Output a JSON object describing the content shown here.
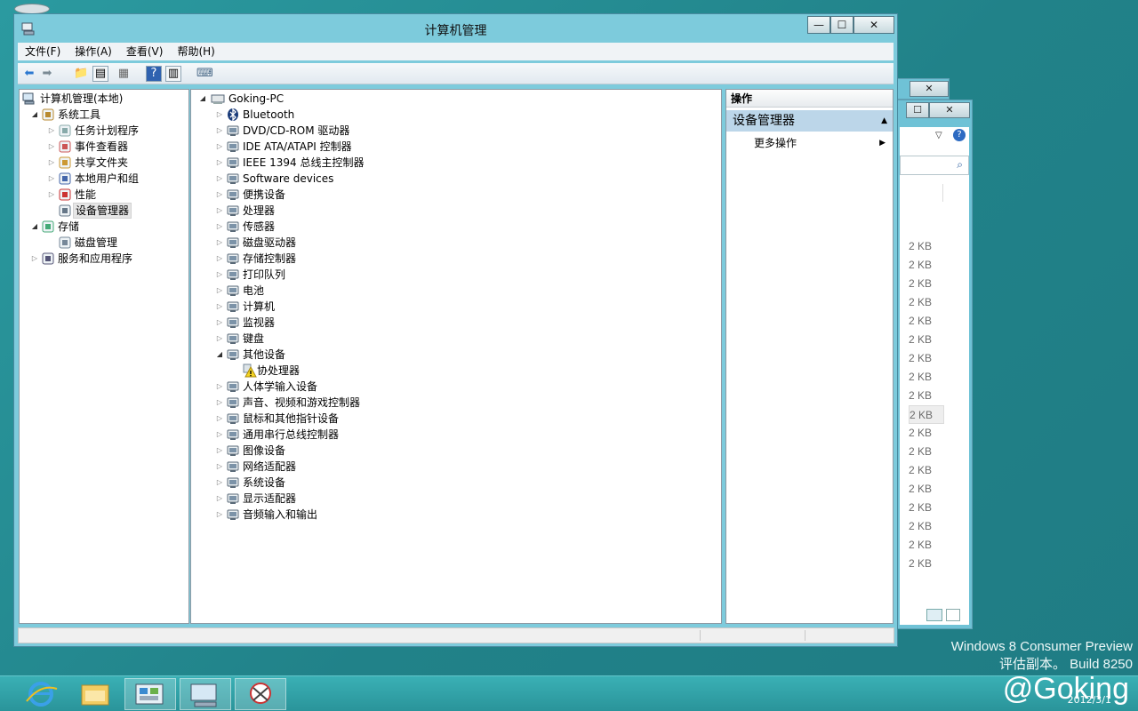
{
  "window": {
    "title": "计算机管理",
    "controls": {
      "minimize": "—",
      "maximize": "☐",
      "close": "✕"
    }
  },
  "menu": [
    "文件(F)",
    "操作(A)",
    "查看(V)",
    "帮助(H)"
  ],
  "left_tree": {
    "root": "计算机管理(本地)",
    "items": [
      {
        "label": "系统工具",
        "level": 1
      },
      {
        "label": "任务计划程序",
        "level": 2
      },
      {
        "label": "事件查看器",
        "level": 2
      },
      {
        "label": "共享文件夹",
        "level": 2
      },
      {
        "label": "本地用户和组",
        "level": 2
      },
      {
        "label": "性能",
        "level": 2
      },
      {
        "label": "设备管理器",
        "level": 2
      },
      {
        "label": "存储",
        "level": 1
      },
      {
        "label": "磁盘管理",
        "level": 2
      },
      {
        "label": "服务和应用程序",
        "level": 1
      }
    ]
  },
  "device_tree": {
    "root": "Goking-PC",
    "items": [
      {
        "label": "Bluetooth",
        "icon": "bluetooth-icon"
      },
      {
        "label": "DVD/CD-ROM 驱动器",
        "icon": "dvd-drive-icon"
      },
      {
        "label": "IDE ATA/ATAPI 控制器",
        "icon": "ide-controller-icon"
      },
      {
        "label": "IEEE 1394 总线主控制器",
        "icon": "ieee1394-icon"
      },
      {
        "label": "Software devices",
        "icon": "software-device-icon"
      },
      {
        "label": "便携设备",
        "icon": "portable-device-icon"
      },
      {
        "label": "处理器",
        "icon": "processor-icon"
      },
      {
        "label": "传感器",
        "icon": "sensor-icon"
      },
      {
        "label": "磁盘驱动器",
        "icon": "disk-drive-icon"
      },
      {
        "label": "存储控制器",
        "icon": "storage-controller-icon"
      },
      {
        "label": "打印队列",
        "icon": "printer-icon"
      },
      {
        "label": "电池",
        "icon": "battery-icon"
      },
      {
        "label": "计算机",
        "icon": "computer-icon"
      },
      {
        "label": "监视器",
        "icon": "monitor-icon"
      },
      {
        "label": "键盘",
        "icon": "keyboard-icon"
      },
      {
        "label": "其他设备",
        "icon": "other-device-icon",
        "expanded": true
      },
      {
        "label": "协处理器",
        "icon": "warning-device-icon",
        "child": true
      },
      {
        "label": "人体学输入设备",
        "icon": "hid-icon"
      },
      {
        "label": "声音、视频和游戏控制器",
        "icon": "sound-icon"
      },
      {
        "label": "鼠标和其他指针设备",
        "icon": "mouse-icon"
      },
      {
        "label": "通用串行总线控制器",
        "icon": "usb-icon"
      },
      {
        "label": "图像设备",
        "icon": "imaging-device-icon"
      },
      {
        "label": "网络适配器",
        "icon": "network-adapter-icon"
      },
      {
        "label": "系统设备",
        "icon": "system-device-icon"
      },
      {
        "label": "显示适配器",
        "icon": "display-adapter-icon"
      },
      {
        "label": "音频输入和输出",
        "icon": "audio-io-icon"
      }
    ]
  },
  "actions": {
    "header": "操作",
    "section": "设备管理器",
    "more": "更多操作"
  },
  "background_window": {
    "sizes": [
      "2 KB",
      "2 KB",
      "2 KB",
      "2 KB",
      "2 KB",
      "2 KB",
      "2 KB",
      "2 KB",
      "2 KB",
      "2 KB",
      "2 KB",
      "2 KB",
      "2 KB",
      "2 KB",
      "2 KB",
      "2 KB",
      "2 KB",
      "2 KB"
    ]
  },
  "watermark": {
    "line1": "Windows 8 Consumer Preview",
    "line2": "评估副本。 Build 8250",
    "handle": "@Goking",
    "date": "2012/3/1"
  },
  "colors": {
    "accent": "#7dcbdc",
    "taskbar": "#2f9ea4",
    "selection": "#bcd6e9"
  }
}
